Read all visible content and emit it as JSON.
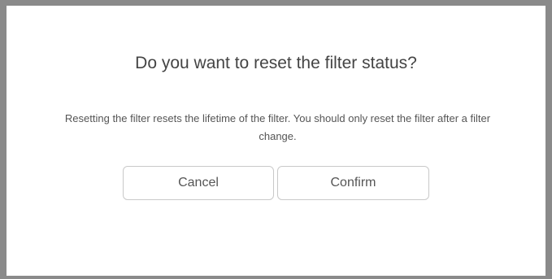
{
  "dialog": {
    "title": "Do you want to reset the filter status?",
    "message_line1": "Resetting the filter resets the lifetime of the filter. You should only reset the filter after a filter",
    "message_line2": "change.",
    "cancel_label": "Cancel",
    "confirm_label": "Confirm"
  },
  "colors": {
    "frame": "#8a8a8a",
    "text": "#444444",
    "button_border": "#c9c9c9"
  }
}
